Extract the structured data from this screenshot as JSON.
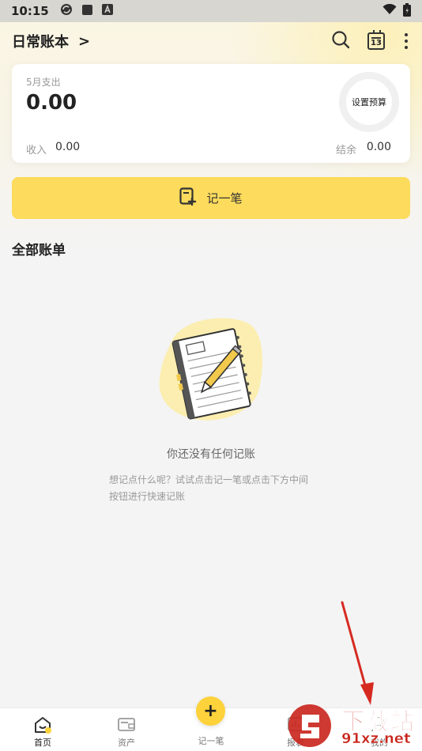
{
  "status_bar": {
    "time": "10:15"
  },
  "header": {
    "title": "日常账本",
    "chevron": ">",
    "calendar_day": "13"
  },
  "summary": {
    "month_label": "5月支出",
    "expense": "0.00",
    "budget_button": "设置预算",
    "income_label": "收入",
    "income": "0.00",
    "balance_label": "结余",
    "balance": "0.00"
  },
  "record_button": {
    "label": "记一笔"
  },
  "section": {
    "title": "全部账单"
  },
  "empty_state": {
    "title": "你还没有任何记账",
    "description": "想记点什么呢？试试点击记一笔或点击下方中间按钮进行快速记账"
  },
  "bottom_nav": {
    "items": [
      {
        "label": "首页",
        "icon": "home-icon",
        "active": true
      },
      {
        "label": "资产",
        "icon": "wallet-icon",
        "active": false
      },
      {
        "label": "记一笔",
        "icon": "plus-icon",
        "active": false
      },
      {
        "label": "报表",
        "icon": "report-icon",
        "active": false
      },
      {
        "label": "我的",
        "icon": "profile-icon",
        "active": false
      }
    ],
    "fab_symbol": "+"
  },
  "watermark": {
    "text_top": "下载站",
    "text_bottom": "91xz.net"
  },
  "colors": {
    "accent": "#fddb5c",
    "fab": "#fdd23a",
    "annotation_arrow": "#d62a21",
    "watermark": "#c9241b"
  }
}
